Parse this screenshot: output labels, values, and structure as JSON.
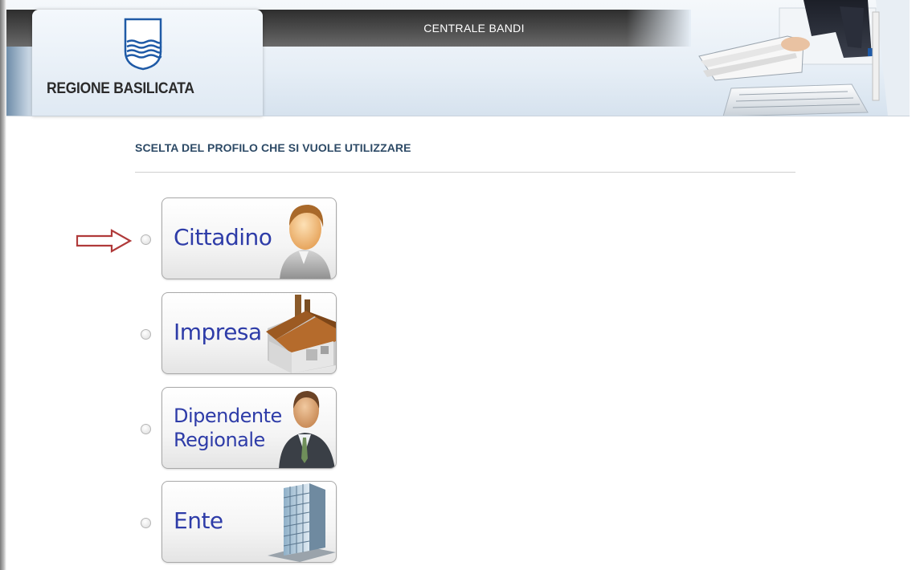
{
  "header": {
    "site_title": "CENTRALE BANDI",
    "region_name": "REGIONE BASILICATA"
  },
  "main": {
    "title": "SCELTA DEL PROFILO CHE SI VUOLE UTILIZZARE",
    "profiles": [
      {
        "label": "Cittadino",
        "icon": "person-icon",
        "selected": false
      },
      {
        "label": "Impresa",
        "icon": "factory-icon",
        "selected": false
      },
      {
        "label_line1": "Dipendente",
        "label_line2": "Regionale",
        "icon": "businessman-icon",
        "selected": false
      },
      {
        "label": "Ente",
        "icon": "building-icon",
        "selected": false
      }
    ]
  },
  "colors": {
    "arrow": "#b03a3a",
    "profile_text": "#2e3ca8",
    "title_text": "#2d4a66"
  }
}
